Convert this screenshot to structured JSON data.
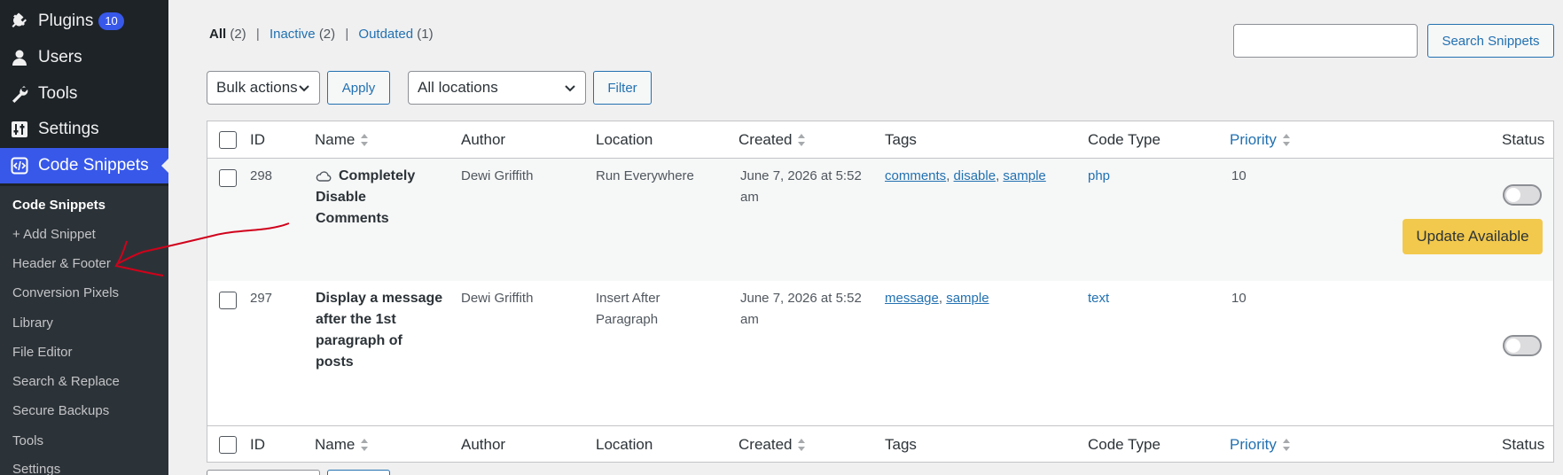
{
  "sidebar": {
    "menu": [
      {
        "label": "Plugins",
        "icon": "plug-icon",
        "badge": "10"
      },
      {
        "label": "Users",
        "icon": "user-icon"
      },
      {
        "label": "Tools",
        "icon": "wrench-icon"
      },
      {
        "label": "Settings",
        "icon": "settings-sliders-icon"
      },
      {
        "label": "Code Snippets",
        "icon": "code-snippets-icon",
        "current": true
      }
    ],
    "submenu": [
      {
        "label": "Code Snippets",
        "active": true
      },
      {
        "label": "+ Add Snippet"
      },
      {
        "label": "Header & Footer"
      },
      {
        "label": "Conversion Pixels"
      },
      {
        "label": "Library"
      },
      {
        "label": "File Editor"
      },
      {
        "label": "Search & Replace"
      },
      {
        "label": "Secure Backups"
      },
      {
        "label": "Tools"
      },
      {
        "label": "Settings"
      }
    ]
  },
  "filters": {
    "all": "All",
    "all_count": "(2)",
    "inactive": "Inactive",
    "inactive_count": "(2)",
    "outdated": "Outdated",
    "outdated_count": "(1)",
    "separator": "|"
  },
  "search": {
    "placeholder": "",
    "button": "Search Snippets"
  },
  "toolbar": {
    "bulk_actions": "Bulk actions",
    "apply": "Apply",
    "locations": "All locations",
    "filter": "Filter"
  },
  "table": {
    "columns": {
      "id": "ID",
      "name": "Name",
      "author": "Author",
      "location": "Location",
      "created": "Created",
      "tags": "Tags",
      "code_type": "Code Type",
      "priority": "Priority",
      "status": "Status"
    },
    "rows": [
      {
        "id": "298",
        "name_lines": [
          "Completely",
          "Disable",
          "Comments"
        ],
        "author": "Dewi Griffith",
        "location_lines": [
          "Run Everywhere"
        ],
        "created_lines": [
          "June 7, 2026 at 5:52",
          "am"
        ],
        "tags": [
          "comments",
          "disable",
          "sample"
        ],
        "code_type": "php",
        "priority": "10",
        "status_active": false,
        "update_label": "Update Available"
      },
      {
        "id": "297",
        "name_lines": [
          "Display a message",
          "after the 1st",
          "paragraph of",
          "posts"
        ],
        "author": "Dewi Griffith",
        "location_lines": [
          "Insert After",
          "Paragraph"
        ],
        "created_lines": [
          "June 7, 2026 at 5:52",
          "am"
        ],
        "tags": [
          "message",
          "sample"
        ],
        "code_type": "text",
        "priority": "10",
        "status_active": false
      }
    ]
  },
  "colors": {
    "sidebar_bg": "#1d2327",
    "accent": "#3858e9",
    "link": "#2271b1",
    "update": "#f2c94c",
    "annotation": "#d0021b"
  }
}
